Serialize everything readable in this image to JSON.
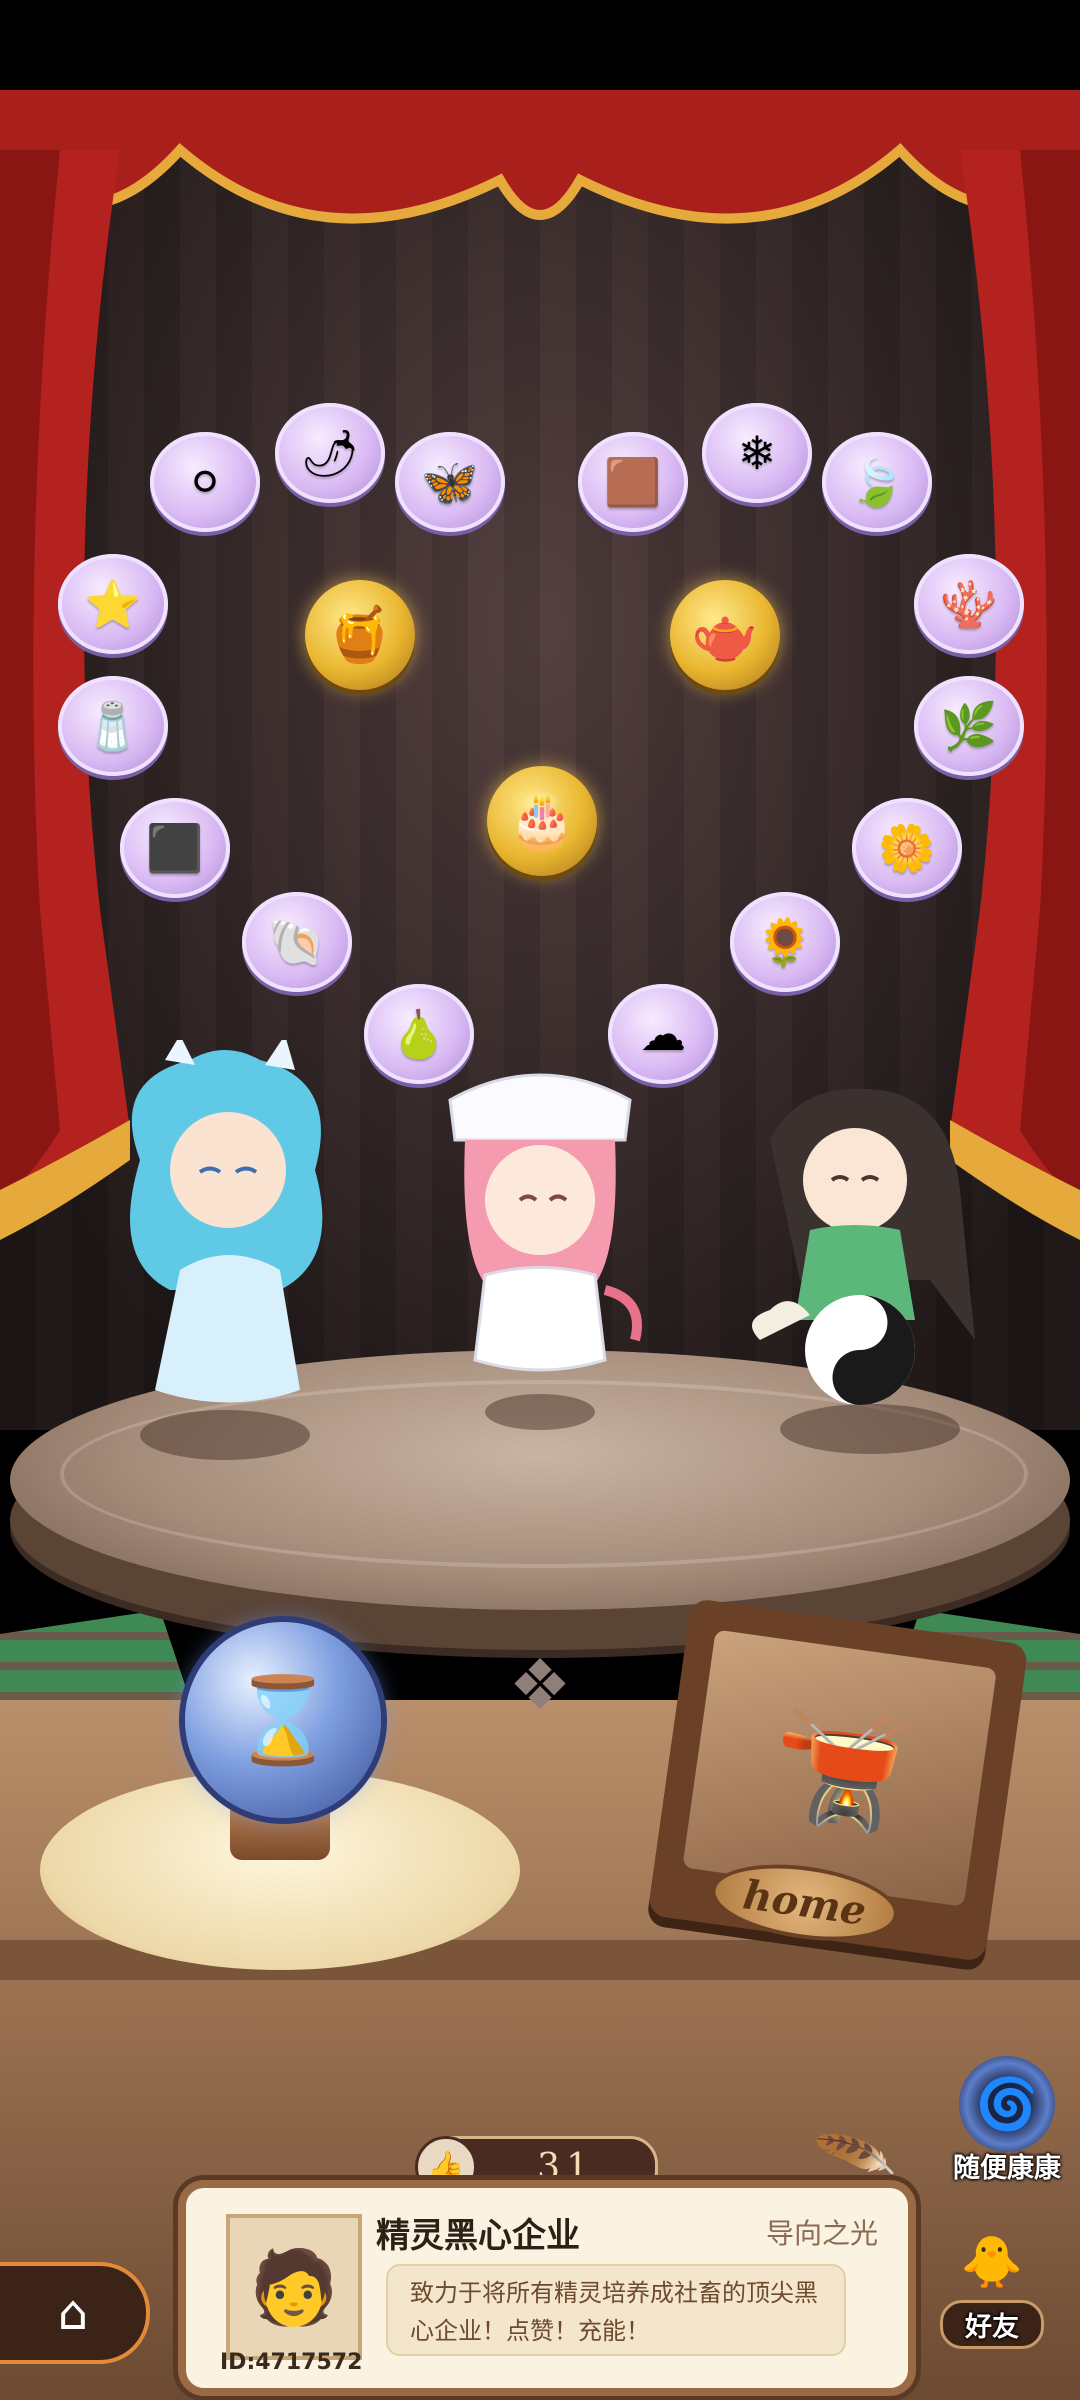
{
  "scene": {
    "slot_items": [
      {
        "icon": "pearl"
      },
      {
        "icon": "chili"
      },
      {
        "icon": "butterfly"
      },
      {
        "icon": "copper-ore"
      },
      {
        "icon": "white-crystal"
      },
      {
        "icon": "leaf"
      },
      {
        "icon": "star"
      },
      {
        "icon": "coral"
      },
      {
        "icon": "salt-crystal"
      },
      {
        "icon": "herb"
      },
      {
        "icon": "coal-ore"
      },
      {
        "icon": "blue-flower"
      },
      {
        "icon": "shell"
      },
      {
        "icon": "yellow-flower"
      },
      {
        "icon": "potion-bottle"
      },
      {
        "icon": "cloud-puff"
      }
    ],
    "gold_items": [
      {
        "icon": "gold-pot"
      },
      {
        "icon": "gold-teapot"
      },
      {
        "icon": "gold-cake"
      }
    ],
    "characters": [
      {
        "name": "ice-spirit"
      },
      {
        "name": "pink-spirit"
      },
      {
        "name": "fisher-spirit"
      }
    ],
    "colors": {
      "curtain": "#b3221f",
      "slot": "#d9b9f3",
      "gold": "#e9b630"
    }
  },
  "frame": {
    "plate_text": "home"
  },
  "side_buttons": {
    "random": {
      "label": "随便康康"
    },
    "friends": {
      "label": "好友"
    }
  },
  "likes": {
    "count": "31"
  },
  "profile": {
    "title": "精灵黑心企业",
    "rank": "导向之光",
    "description": "致力于将所有精灵培养成社畜的顶尖黑心企业！点赞！充能！",
    "id": "ID:4717572"
  }
}
